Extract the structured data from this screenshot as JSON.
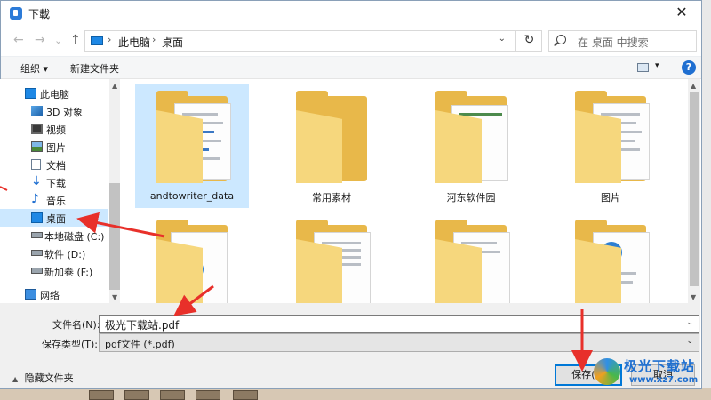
{
  "window": {
    "title": "下載",
    "close_glyph": "✕"
  },
  "nav": {
    "back_glyph": "←",
    "forward_glyph": "→",
    "recent_glyph": "⌄",
    "up_glyph": "↑",
    "breadcrumb": [
      "此电脑",
      "桌面"
    ],
    "crumb_sep": "›",
    "dropdown_glyph": "⌄",
    "refresh_glyph": "↻",
    "search_placeholder": "在 桌面 中搜索"
  },
  "toolbar": {
    "organize": "组织 ▾",
    "new_folder": "新建文件夹",
    "view_dd": "▾",
    "help": "?"
  },
  "sidebar": {
    "items": [
      {
        "label": "此电脑",
        "icon": "computer-icon"
      },
      {
        "label": "3D 对象",
        "icon": "3d-objects-icon"
      },
      {
        "label": "视频",
        "icon": "video-icon"
      },
      {
        "label": "图片",
        "icon": "pictures-icon"
      },
      {
        "label": "文档",
        "icon": "documents-icon"
      },
      {
        "label": "下载",
        "icon": "download-icon"
      },
      {
        "label": "音乐",
        "icon": "music-icon"
      },
      {
        "label": "桌面",
        "icon": "desktop-icon",
        "selected": true
      },
      {
        "label": "本地磁盘 (C:)",
        "icon": "drive-icon"
      },
      {
        "label": "软件 (D:)",
        "icon": "drive-icon"
      },
      {
        "label": "新加卷 (F:)",
        "icon": "drive-icon"
      },
      {
        "label": "网络",
        "icon": "network-icon"
      }
    ]
  },
  "folders": [
    {
      "label": "andtowriter_data",
      "selected": true
    },
    {
      "label": "常用素材"
    },
    {
      "label": "河东软件园"
    },
    {
      "label": "图片"
    },
    {
      "label": ""
    },
    {
      "label": ""
    },
    {
      "label": ""
    },
    {
      "label": ""
    }
  ],
  "form": {
    "filename_label": "文件名(N):",
    "filename_value": "极光下载站.pdf",
    "filetype_label": "保存类型(T):",
    "filetype_value": "pdf文件 (*.pdf)",
    "hide_folders": "隐藏文件夹",
    "hide_glyph": "▲",
    "save": "保存(S)",
    "cancel": "取消"
  },
  "watermark": {
    "text": "极光下载站",
    "url": "www.xz7.com"
  },
  "colors": {
    "selection": "#cce8ff",
    "accent": "#0078d7",
    "annotation": "#e8302a",
    "folder": "#e8b84a"
  }
}
